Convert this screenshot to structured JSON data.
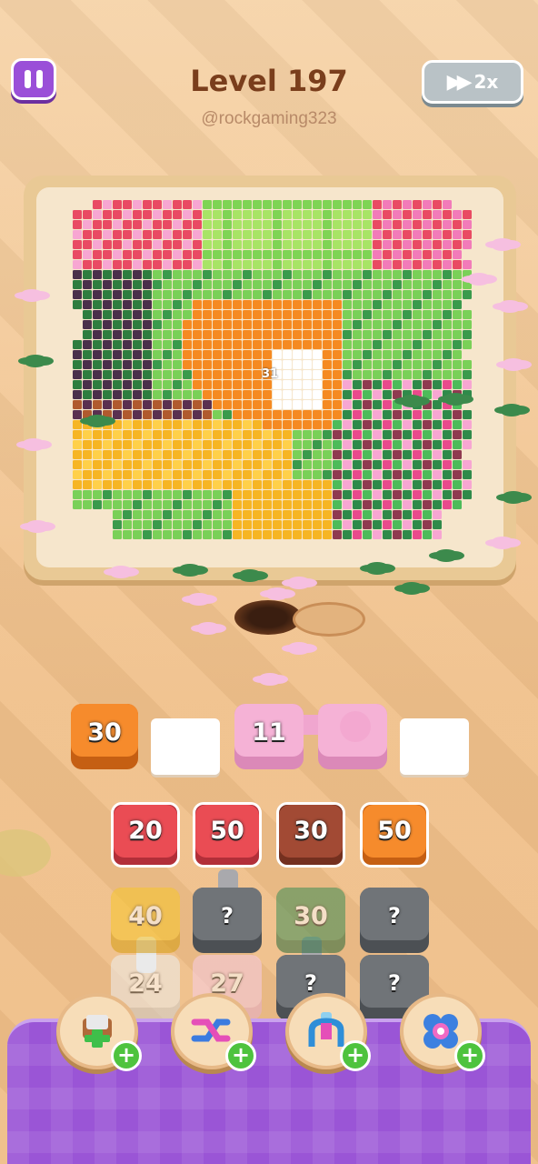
{
  "header": {
    "title": "Level 197",
    "username": "@rockgaming323",
    "speed_label": "2x"
  },
  "board": {
    "counter": "31"
  },
  "slots": [
    {
      "value": "30",
      "color": "#f68b2c",
      "filled": true
    },
    {
      "value": "",
      "filled": false
    },
    {
      "value": "11",
      "color": "#f5b2d6",
      "filled": true
    },
    {
      "value": "",
      "color": "#f5b2d6",
      "filled": true
    },
    {
      "value": "",
      "filled": false
    }
  ],
  "grid": {
    "row1": [
      "20",
      "50",
      "30",
      "50"
    ],
    "row2": [
      "40",
      "?",
      "30",
      "?"
    ],
    "row3": [
      "24",
      "27",
      "?",
      "?"
    ]
  },
  "boosters": [
    {
      "name": "add-slot-icon"
    },
    {
      "name": "shuffle-icon"
    },
    {
      "name": "magnet-claw-icon"
    },
    {
      "name": "flower-icon"
    }
  ]
}
